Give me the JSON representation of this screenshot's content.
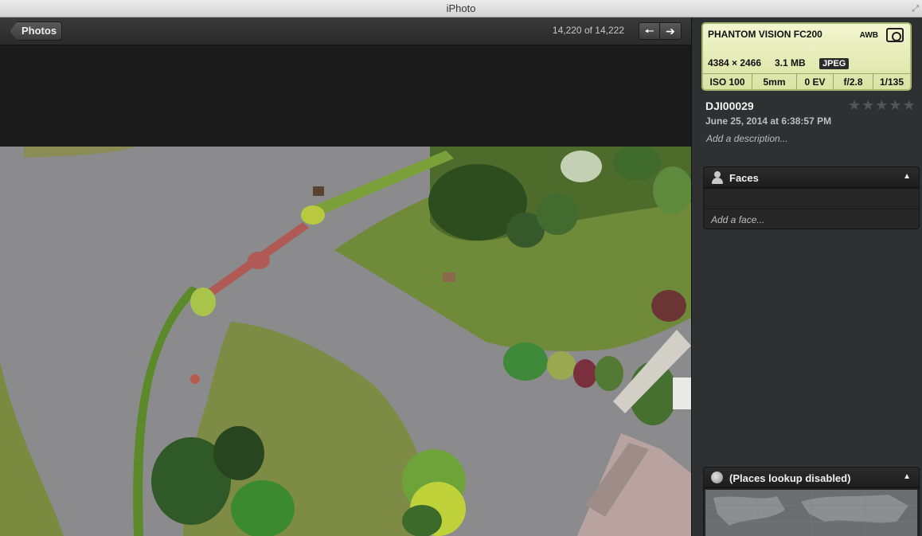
{
  "window": {
    "title": "iPhoto"
  },
  "toolbar": {
    "back_label": "Photos",
    "counter": "14,220 of 14,222",
    "prev_glyph": "🠔",
    "next_glyph": "➔"
  },
  "info": {
    "camera_model": "PHANTOM VISION FC200",
    "white_balance": "AWB",
    "dimensions": "4384 × 2466",
    "file_size": "3.1 MB",
    "format": "JPEG",
    "exif": {
      "iso": "ISO 100",
      "focal": "5mm",
      "ev": "0 EV",
      "aperture": "f/2.8",
      "shutter": "1/135"
    },
    "title": "DJI00029",
    "date": "June 25, 2014 at 6:38:57 PM",
    "description_placeholder": "Add a description...",
    "rating_stars": "★★★★★",
    "rating_value": 0
  },
  "faces": {
    "title": "Faces",
    "toggle": "▲",
    "add_placeholder": "Add a face..."
  },
  "places": {
    "title": "(Places lookup disabled)",
    "toggle": "▲"
  },
  "icons": [
    "back-arrow-icon",
    "left-arrow-icon",
    "right-arrow-icon",
    "camera-icon",
    "star-icon",
    "person-icon",
    "globe-icon",
    "collapse-triangle-icon"
  ],
  "colors": {
    "info_card": "#e6edb8",
    "sidebar": "#2f3031",
    "toolbar": "#2e2e2e"
  }
}
